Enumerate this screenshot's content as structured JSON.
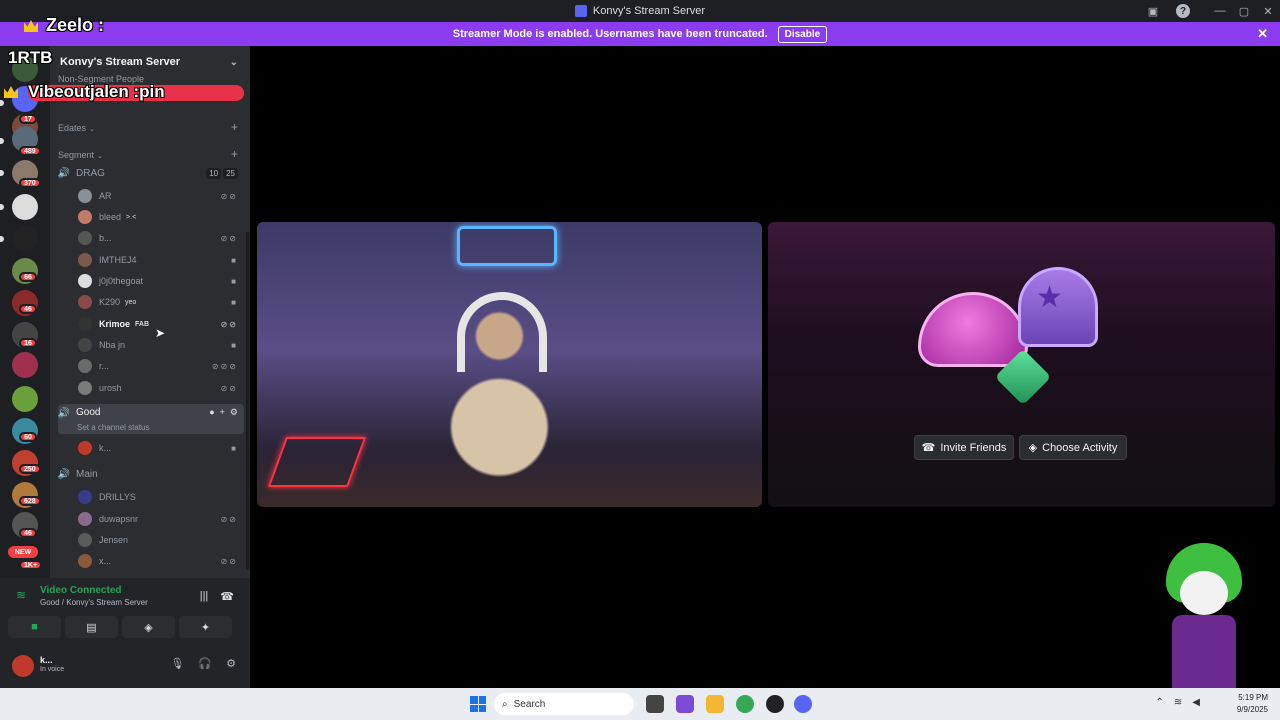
{
  "window": {
    "title": "Konvy's Stream Server",
    "controls": [
      "—",
      "▢",
      "✕"
    ]
  },
  "banner": {
    "text": "Streamer Mode is enabled. Usernames have been truncated.",
    "disable_label": "Disable"
  },
  "overlay": {
    "chatter1": "Zeelo :",
    "chatter2": "1RTB",
    "chatter3": "Vibeoutjalen :pin"
  },
  "rail": {
    "badges": [
      "17",
      "489",
      "370",
      "66",
      "46",
      "16",
      "60",
      "250",
      "628",
      "46",
      "1K+"
    ],
    "new_labels": [
      "NEW"
    ]
  },
  "sidebar": {
    "server_name": "Konvy's Stream Server",
    "categories": [
      {
        "name": "Non-Segment People"
      },
      {
        "name": "Edates"
      },
      {
        "name": "Segment"
      }
    ],
    "channels": {
      "drag": {
        "name": "DRAG",
        "video_count": "10",
        "user_count": "25"
      },
      "good": {
        "name": "Good",
        "status": "Set a channel status"
      },
      "main": {
        "name": "Main"
      }
    },
    "drag_users": [
      {
        "name": "AR"
      },
      {
        "name": "bleed",
        "tag": ">.<"
      },
      {
        "name": "b..."
      },
      {
        "name": "IMTHEJ4"
      },
      {
        "name": "j0j0thegoat"
      },
      {
        "name": "K290",
        "tag": "yeo"
      },
      {
        "name": "Krimoe",
        "tag": "FAB"
      },
      {
        "name": "Nba jn"
      },
      {
        "name": "r..."
      },
      {
        "name": "urosh"
      }
    ],
    "good_users": [
      {
        "name": "k..."
      }
    ],
    "main_users": [
      {
        "name": "DRILLYS"
      },
      {
        "name": "duwapsnr"
      },
      {
        "name": "Jensen"
      },
      {
        "name": "x..."
      }
    ]
  },
  "voice": {
    "title": "Video Connected",
    "location": "Good / Konvy's Stream Server",
    "user_name": "k...",
    "user_status": "In voice"
  },
  "activity": {
    "invite_label": "Invite Friends",
    "choose_label": "Choose Activity"
  },
  "taskbar": {
    "search_placeholder": "Search",
    "time": "5:19 PM",
    "date": "9/9/2025"
  }
}
